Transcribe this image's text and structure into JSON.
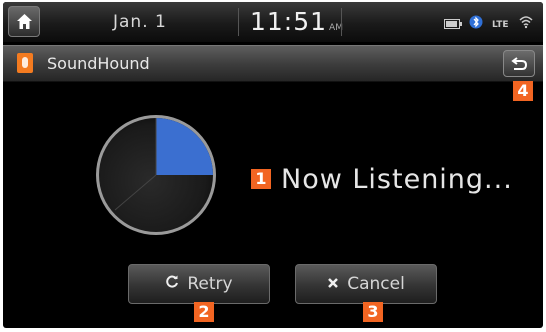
{
  "statusbar": {
    "date": "Jan.  1",
    "time": "11:51",
    "ampm": "AM",
    "icons": [
      "battery-icon",
      "bluetooth-icon",
      "network-icon",
      "wifi-signal-icon"
    ]
  },
  "titlebar": {
    "app_name": "SoundHound",
    "app_icon": "soundhound-icon",
    "back_icon": "back-arrow-icon"
  },
  "main": {
    "status_text": "Now Listening...",
    "listening_progress": 0.25
  },
  "buttons": {
    "retry_label": "Retry",
    "retry_icon": "retry-icon",
    "cancel_label": "Cancel",
    "cancel_icon": "cancel-icon"
  },
  "callouts": {
    "status": "1",
    "retry": "2",
    "cancel": "3",
    "back": "4"
  },
  "colors": {
    "accent_blue": "#3b6fd0",
    "callout_orange": "#f26522",
    "app_icon_orange": "#f47b20"
  }
}
